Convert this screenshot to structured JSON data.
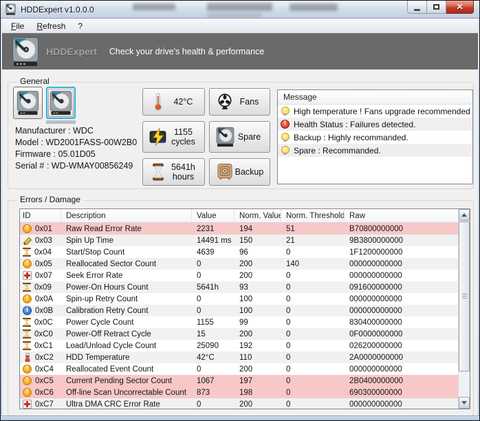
{
  "window": {
    "title": "HDDExpert v1.0.0.0",
    "controls": {
      "minimize": "minimize",
      "maximize": "maximize",
      "close": "close"
    }
  },
  "menu": {
    "items": [
      {
        "accel": "F",
        "rest": "ile"
      },
      {
        "accel": "R",
        "rest": "efresh"
      },
      {
        "accel": "",
        "rest": "?"
      }
    ]
  },
  "banner": {
    "app_name": "HDDExpert",
    "tagline": "Check your drive's health & performance"
  },
  "general": {
    "label": "General",
    "drives": [
      {
        "icon": "hdd-drive-icon",
        "selected": false
      },
      {
        "icon": "hdd-drive-icon",
        "selected": true
      }
    ],
    "info": [
      "Manufacturer : WDC",
      "Model : WD2001FASS-00W2B0",
      "Firmware : 05.01D05",
      "Serial # : WD-WMAY00856249"
    ],
    "stats": [
      {
        "icon": "thermometer-icon",
        "line1": "42°C",
        "line2": ""
      },
      {
        "icon": "fan-icon",
        "line1": "Fans",
        "line2": ""
      },
      {
        "icon": "power-cycles-icon",
        "line1": "1155",
        "line2": "cycles"
      },
      {
        "icon": "spare-drive-icon",
        "line1": "Spare",
        "line2": ""
      },
      {
        "icon": "hourglass-icon",
        "line1": "5641h",
        "line2": "hours"
      },
      {
        "icon": "backup-safe-icon",
        "line1": "Backup",
        "line2": ""
      }
    ]
  },
  "message": {
    "header": "Message",
    "items": [
      {
        "icon": "bulb-icon",
        "text": "High temperature ! Fans upgrade recommended"
      },
      {
        "icon": "error-icon",
        "text": "Health Status : Failures detected."
      },
      {
        "icon": "bulb-icon",
        "text": "Backup : Highly recommanded."
      },
      {
        "icon": "bulb-icon",
        "text": "Spare : Recommanded."
      }
    ]
  },
  "errors": {
    "label": "Errors / Damage",
    "columns": [
      "ID",
      "Description",
      "Value",
      "Norm. Value",
      "Norm. Threshold",
      "Raw"
    ],
    "rows": [
      {
        "icon": "warning-icon",
        "id": "0x01",
        "description": "Raw Read Error Rate",
        "value": "2231",
        "norm_value": "194",
        "norm_threshold": "51",
        "raw": "B70800000000",
        "highlight": true
      },
      {
        "icon": "pencil-icon",
        "id": "0x03",
        "description": "Spin Up Time",
        "value": "14491 ms",
        "norm_value": "150",
        "norm_threshold": "21",
        "raw": "9B3800000000",
        "highlight": false
      },
      {
        "icon": "hourglass-icon",
        "id": "0x04",
        "description": "Start/Stop Count",
        "value": "4639",
        "norm_value": "96",
        "norm_threshold": "0",
        "raw": "1F1200000000",
        "highlight": false
      },
      {
        "icon": "warning-icon",
        "id": "0x05",
        "description": "Reallocated Sector Count",
        "value": "0",
        "norm_value": "200",
        "norm_threshold": "140",
        "raw": "000000000000",
        "highlight": false
      },
      {
        "icon": "firstaid-icon",
        "id": "0x07",
        "description": "Seek Error Rate",
        "value": "0",
        "norm_value": "200",
        "norm_threshold": "0",
        "raw": "000000000000",
        "highlight": false
      },
      {
        "icon": "hourglass-icon",
        "id": "0x09",
        "description": "Power-On Hours Count",
        "value": "5641h",
        "norm_value": "93",
        "norm_threshold": "0",
        "raw": "091600000000",
        "highlight": false
      },
      {
        "icon": "warning-icon",
        "id": "0x0A",
        "description": "Spin-up Retry Count",
        "value": "0",
        "norm_value": "100",
        "norm_threshold": "0",
        "raw": "000000000000",
        "highlight": false
      },
      {
        "icon": "info-icon",
        "id": "0x0B",
        "description": "Calibration Retry Count",
        "value": "0",
        "norm_value": "100",
        "norm_threshold": "0",
        "raw": "000000000000",
        "highlight": false
      },
      {
        "icon": "hourglass-icon",
        "id": "0x0C",
        "description": "Power Cycle Count",
        "value": "1155",
        "norm_value": "99",
        "norm_threshold": "0",
        "raw": "830400000000",
        "highlight": false
      },
      {
        "icon": "hourglass-icon",
        "id": "0xC0",
        "description": "Power-Off Retract Cycle",
        "value": "15",
        "norm_value": "200",
        "norm_threshold": "0",
        "raw": "0F0000000000",
        "highlight": false
      },
      {
        "icon": "hourglass-icon",
        "id": "0xC1",
        "description": "Load/Unload Cycle Count",
        "value": "25090",
        "norm_value": "192",
        "norm_threshold": "0",
        "raw": "026200000000",
        "highlight": false
      },
      {
        "icon": "thermometer-icon",
        "id": "0xC2",
        "description": "HDD Temperature",
        "value": "42°C",
        "norm_value": "110",
        "norm_threshold": "0",
        "raw": "2A0000000000",
        "highlight": false
      },
      {
        "icon": "warning-icon",
        "id": "0xC4",
        "description": "Reallocated Event Count",
        "value": "0",
        "norm_value": "200",
        "norm_threshold": "0",
        "raw": "000000000000",
        "highlight": false
      },
      {
        "icon": "warning-icon",
        "id": "0xC5",
        "description": "Current Pending Sector Count",
        "value": "1067",
        "norm_value": "197",
        "norm_threshold": "0",
        "raw": "2B0400000000",
        "highlight": true
      },
      {
        "icon": "warning-icon",
        "id": "0xC6",
        "description": "Off-line Scan Uncorrectable Count",
        "value": "873",
        "norm_value": "198",
        "norm_threshold": "0",
        "raw": "690300000000",
        "highlight": true
      },
      {
        "icon": "firstaid-icon",
        "id": "0xC7",
        "description": "Ultra DMA CRC Error Rate",
        "value": "0",
        "norm_value": "200",
        "norm_threshold": "0",
        "raw": "000000000000",
        "highlight": false
      }
    ]
  }
}
